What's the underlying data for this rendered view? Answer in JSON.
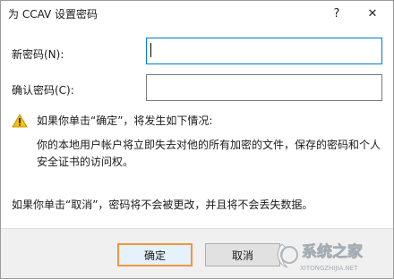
{
  "titlebar": {
    "title": "为 CCAV 设置密码",
    "help_symbol": "?",
    "close_symbol": "✕"
  },
  "form": {
    "new_password_label": "新密码(N):",
    "new_password_value": "",
    "confirm_password_label": "确认密码(C):",
    "confirm_password_value": ""
  },
  "warning": {
    "icon": "warning-triangle-icon",
    "heading": "如果你单击“确定”，将发生如下情况:",
    "detail_line1": "你的本地用户帐户将立即失去对他的所有加密的文件，保存的密码和个人",
    "detail_line2": "安全证书的访问权。"
  },
  "cancel_note": "如果你单击“取消”，密码将不会被更改，并且将不会丢失数据。",
  "buttons": {
    "ok_label": "确定",
    "cancel_label": "取消"
  },
  "watermark": {
    "brand": "系统之家",
    "url": "XITONGZHIJIA.NET"
  },
  "colors": {
    "ok_highlight": "#f0963c",
    "focus_border": "#0078d7",
    "warning_fill": "#f5c400"
  }
}
